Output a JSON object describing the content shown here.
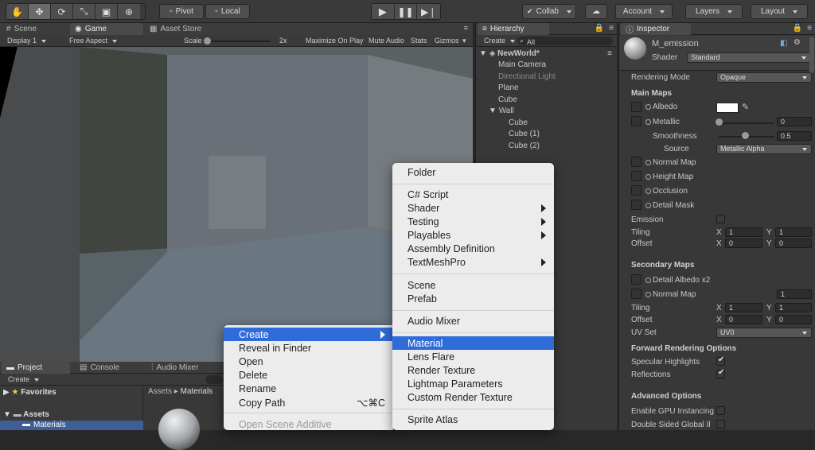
{
  "toolbar": {
    "tools": [
      "hand-tool-icon",
      "move-tool-icon",
      "rotate-tool-icon",
      "scale-tool-icon",
      "rect-tool-icon",
      "transform-tool-icon"
    ],
    "pivot": "Pivot",
    "local": "Local",
    "collab": "Collab",
    "account": "Account",
    "layers": "Layers",
    "layout": "Layout"
  },
  "scene_panel": {
    "tabs": [
      "Scene",
      "Game",
      "Asset Store"
    ],
    "display": "Display 1",
    "aspect": "Free Aspect",
    "scale_label": "Scale",
    "scale_value": "2x",
    "maximize": "Maximize On Play",
    "mute": "Mute Audio",
    "stats": "Stats",
    "gizmos": "Gizmos"
  },
  "hierarchy": {
    "tab": "Hierarchy",
    "create": "Create",
    "search_placeholder": "All",
    "scene": "NewWorld*",
    "items": [
      "Main Camera",
      "Directional Light",
      "Plane",
      "Cube",
      "Wall",
      "Cube",
      "Cube (1)",
      "Cube (2)"
    ]
  },
  "inspector": {
    "tab": "Inspector",
    "material_name": "M_emission",
    "shader_label": "Shader",
    "shader_value": "Standard",
    "rendering_mode_label": "Rendering Mode",
    "rendering_mode_value": "Opaque",
    "main_maps": "Main Maps",
    "albedo": "Albedo",
    "metallic": "Metallic",
    "metallic_value": "0",
    "smoothness": "Smoothness",
    "smoothness_value": "0.5",
    "source": "Source",
    "source_value": "Metallic Alpha",
    "normal_map": "Normal Map",
    "height_map": "Height Map",
    "occlusion": "Occlusion",
    "detail_mask": "Detail Mask",
    "emission": "Emission",
    "tiling": "Tiling",
    "offset": "Offset",
    "x": "X",
    "y": "Y",
    "tiling_x": "1",
    "tiling_y": "1",
    "offset_x": "0",
    "offset_y": "0",
    "secondary_maps": "Secondary Maps",
    "detail_albedo": "Detail Albedo x2",
    "normal_map2": "Normal Map",
    "normal_map2_value": "1",
    "tiling2_x": "1",
    "tiling2_y": "1",
    "offset2_x": "0",
    "offset2_y": "0",
    "uv_set": "UV Set",
    "uv_set_value": "UV0",
    "forward_options": "Forward Rendering Options",
    "specular_highlights": "Specular Highlights",
    "reflections": "Reflections",
    "advanced_options": "Advanced Options",
    "gpu_instancing": "Enable GPU Instancing",
    "double_sided": "Double Sided Global Il"
  },
  "project_panel": {
    "tabs": [
      "Project",
      "Console",
      "Audio Mixer"
    ],
    "create": "Create",
    "favorites": "Favorites",
    "assets": "Assets",
    "materials": "Materials",
    "breadcrumb_root": "Assets",
    "breadcrumb_sep": "▸",
    "breadcrumb_leaf": "Materials"
  },
  "context_menu": {
    "items": [
      "Create",
      "Reveal in Finder",
      "Open",
      "Delete",
      "Rename",
      "Copy Path",
      "Open Scene Additive"
    ],
    "copy_path_shortcut": "⌥⌘C"
  },
  "create_menu": {
    "items": [
      "Folder",
      "C# Script",
      "Shader",
      "Testing",
      "Playables",
      "Assembly Definition",
      "TextMeshPro",
      "Scene",
      "Prefab",
      "Audio Mixer",
      "Material",
      "Lens Flare",
      "Render Texture",
      "Lightmap Parameters",
      "Custom Render Texture",
      "Sprite Atlas"
    ]
  },
  "colors": {
    "menu_highlight": "#2f6cd9",
    "panel_bg": "#383838"
  }
}
